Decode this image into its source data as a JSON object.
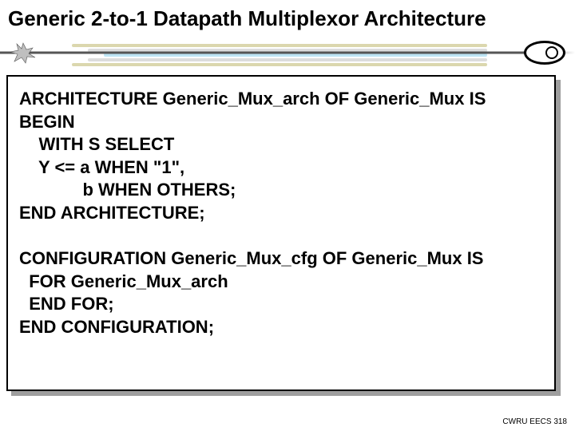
{
  "title": "Generic 2-to-1 Datapath Multiplexor Architecture",
  "code": {
    "line1": "ARCHITECTURE Generic_Mux_arch OF Generic_Mux IS",
    "line2": "BEGIN",
    "line3": "    WITH S SELECT",
    "line4": "    Y <= a WHEN \"1\",",
    "line5": "             b WHEN OTHERS;",
    "line6": "END ARCHITECTURE;",
    "blank1": "",
    "line7": "CONFIGURATION Generic_Mux_cfg OF Generic_Mux IS",
    "line8": "  FOR Generic_Mux_arch",
    "line9": "  END FOR;",
    "line10": "END CONFIGURATION;"
  },
  "footer": "CWRU EECS 318"
}
